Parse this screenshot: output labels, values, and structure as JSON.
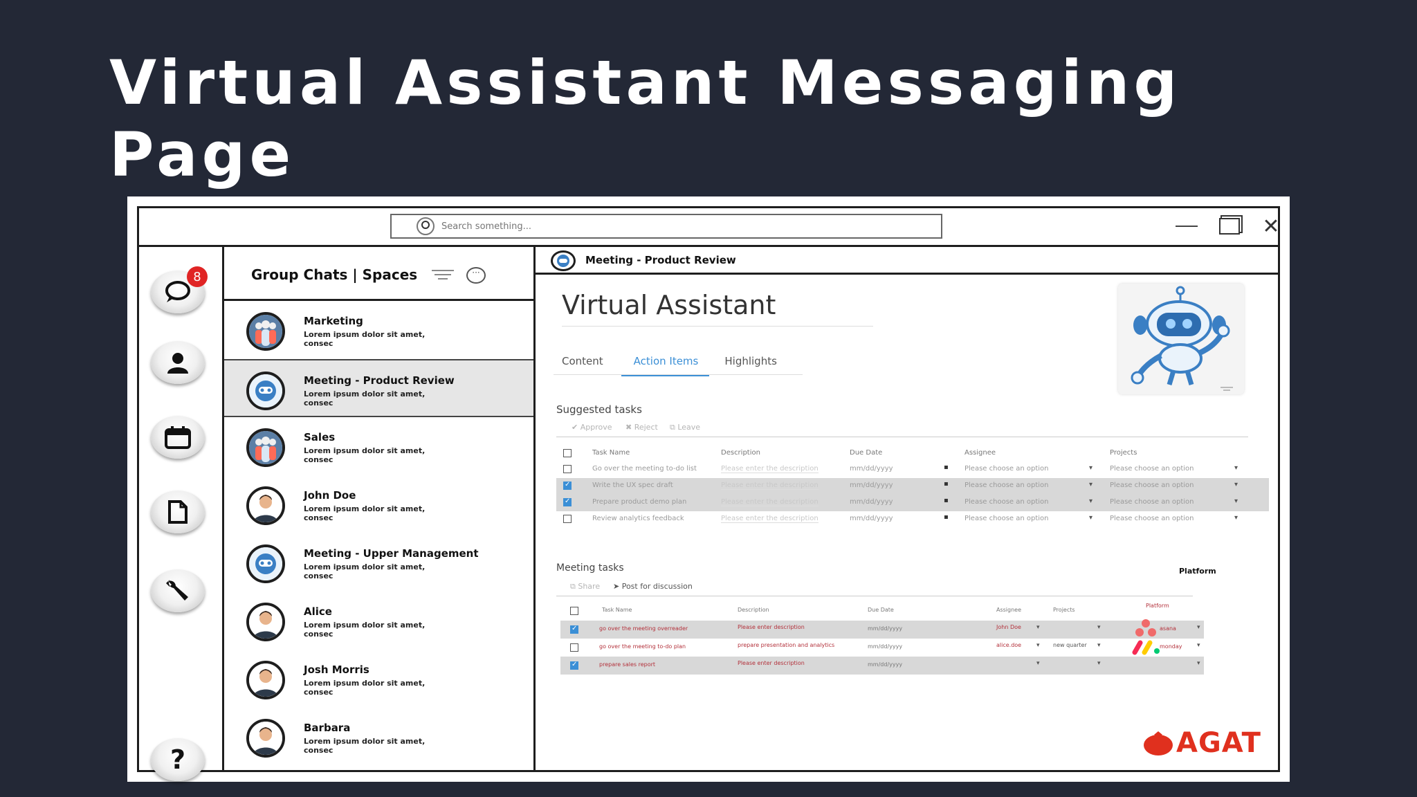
{
  "slide": {
    "title": "Virtual Assistant Messaging Page"
  },
  "titlebar": {
    "search_placeholder": "Search something..."
  },
  "rail": {
    "messages_badge": "8"
  },
  "chatlist": {
    "title": "Group Chats | Spaces",
    "items": [
      {
        "name": "Marketing",
        "preview": "Lorem ipsum dolor sit amet, consec",
        "avatar": "group-icon"
      },
      {
        "name": "Meeting - Product Review",
        "preview": "Lorem ipsum dolor sit amet, consec",
        "avatar": "robot-icon",
        "active": true
      },
      {
        "name": "Sales",
        "preview": "Lorem ipsum dolor sit amet, consec",
        "avatar": "group-icon"
      },
      {
        "name": "John Doe",
        "preview": "Lorem ipsum dolor sit amet, consec",
        "avatar": "person-icon"
      },
      {
        "name": "Meeting - Upper Management",
        "preview": "Lorem ipsum dolor sit amet, consec",
        "avatar": "robot-icon"
      },
      {
        "name": "Alice",
        "preview": "Lorem ipsum dolor sit amet, consec",
        "avatar": "person-icon"
      },
      {
        "name": "Josh Morris",
        "preview": "Lorem ipsum dolor sit amet, consec",
        "avatar": "person-icon"
      },
      {
        "name": "Barbara",
        "preview": "Lorem ipsum dolor sit amet, consec",
        "avatar": "person-icon"
      }
    ]
  },
  "main": {
    "header_title": "Meeting - Product Review",
    "va_title": "Virtual Assistant",
    "tabs": [
      "Content",
      "Action Items",
      "Highlights"
    ],
    "suggested": {
      "label": "Suggested tasks",
      "actions": [
        "✔ Approve",
        "✖ Reject",
        "⧉ Leave"
      ],
      "headers": [
        "Task Name",
        "Description",
        "Due Date",
        "Assignee",
        "Projects"
      ],
      "rows": [
        {
          "checked": false,
          "name": "Go over the meeting to-do list",
          "desc": "Please enter the description",
          "date": "mm/dd/yyyy",
          "assignee": "Please choose an option",
          "project": "Please choose an option"
        },
        {
          "checked": true,
          "name": "Write the UX spec draft",
          "desc": "Please enter the description",
          "date": "mm/dd/yyyy",
          "assignee": "Please choose an option",
          "project": "Please choose an option"
        },
        {
          "checked": true,
          "name": "Prepare product demo plan",
          "desc": "Please enter the description",
          "date": "mm/dd/yyyy",
          "assignee": "Please choose an option",
          "project": "Please choose an option"
        },
        {
          "checked": false,
          "name": "Review analytics feedback",
          "desc": "Please enter the description",
          "date": "mm/dd/yyyy",
          "assignee": "Please choose an option",
          "project": "Please choose an option"
        }
      ]
    },
    "meeting": {
      "label": "Meeting tasks",
      "actions": [
        "⧉ Share",
        "➤ Post for discussion"
      ],
      "platform_label": "Platform",
      "headers": [
        "Task Name",
        "Description",
        "Due Date",
        "Assignee",
        "Projects",
        "Platform"
      ],
      "rows": [
        {
          "checked": true,
          "name": "go over the meeting overreader",
          "desc": "Please enter description",
          "date": "mm/dd/yyyy",
          "assignee": "John Doe",
          "project": "",
          "platform": "asana"
        },
        {
          "checked": false,
          "name": "go over the meeting to-do plan",
          "desc": "prepare presentation and analytics",
          "date": "mm/dd/yyyy",
          "assignee": "alice.doe",
          "project": "new quarter",
          "platform": "monday"
        },
        {
          "checked": true,
          "name": "prepare sales report",
          "desc": "Please enter description",
          "date": "mm/dd/yyyy",
          "assignee": "",
          "project": "",
          "platform": ""
        }
      ]
    },
    "logo_text": "AGAT"
  },
  "colors": {
    "background": "#232836",
    "accent": "#3b8fd6",
    "badge": "#e02424",
    "logo": "#e0301e"
  }
}
